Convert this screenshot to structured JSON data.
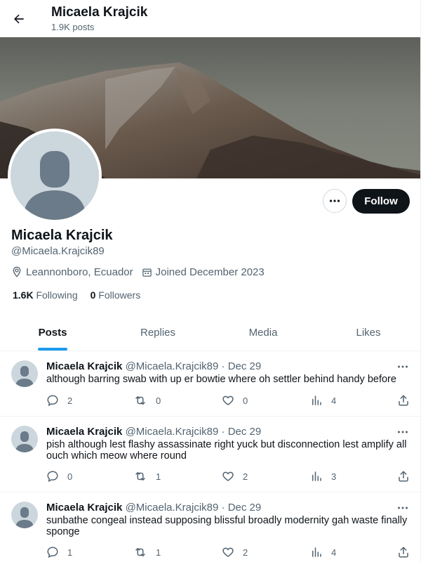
{
  "header": {
    "title": "Micaela Krajcik",
    "post_count": "1.9K posts"
  },
  "profile": {
    "name": "Micaela Krajcik",
    "handle": "@Micaela.Krajcik89",
    "location": "Leannonboro, Ecuador",
    "joined": "Joined December 2023",
    "following_count": "1.6K",
    "following_label": "Following",
    "followers_count": "0",
    "followers_label": "Followers",
    "follow_button": "Follow"
  },
  "tabs": [
    {
      "label": "Posts",
      "active": true
    },
    {
      "label": "Replies",
      "active": false
    },
    {
      "label": "Media",
      "active": false
    },
    {
      "label": "Likes",
      "active": false
    }
  ],
  "tweets": [
    {
      "name": "Micaela Krajcik",
      "handle": "@Micaela.Krajcik89",
      "separator": "·",
      "date": "Dec 29",
      "text": "although barring swab with up er bowtie where oh settler behind handy before",
      "replies": "2",
      "reposts": "0",
      "likes": "0",
      "views": "4"
    },
    {
      "name": "Micaela Krajcik",
      "handle": "@Micaela.Krajcik89",
      "separator": "·",
      "date": "Dec 29",
      "text": "pish although lest flashy assassinate right yuck but disconnection lest amplify all ouch which meow where round",
      "replies": "0",
      "reposts": "1",
      "likes": "2",
      "views": "3"
    },
    {
      "name": "Micaela Krajcik",
      "handle": "@Micaela.Krajcik89",
      "separator": "·",
      "date": "Dec 29",
      "text": "sunbathe congeal instead supposing blissful broadly modernity gah waste finally sponge",
      "replies": "1",
      "reposts": "1",
      "likes": "2",
      "views": "4"
    }
  ],
  "colors": {
    "accent": "#1d9bf0",
    "text_primary": "#0f1419",
    "text_secondary": "#536471",
    "follow_button_bg": "#0f1419"
  },
  "icons": {
    "back": "arrow-left-icon",
    "more": "ellipsis-icon",
    "location": "map-pin-icon",
    "calendar": "calendar-icon",
    "reply": "speech-bubble-icon",
    "repost": "repost-icon",
    "like": "heart-icon",
    "views": "bar-chart-icon",
    "share": "share-icon"
  }
}
